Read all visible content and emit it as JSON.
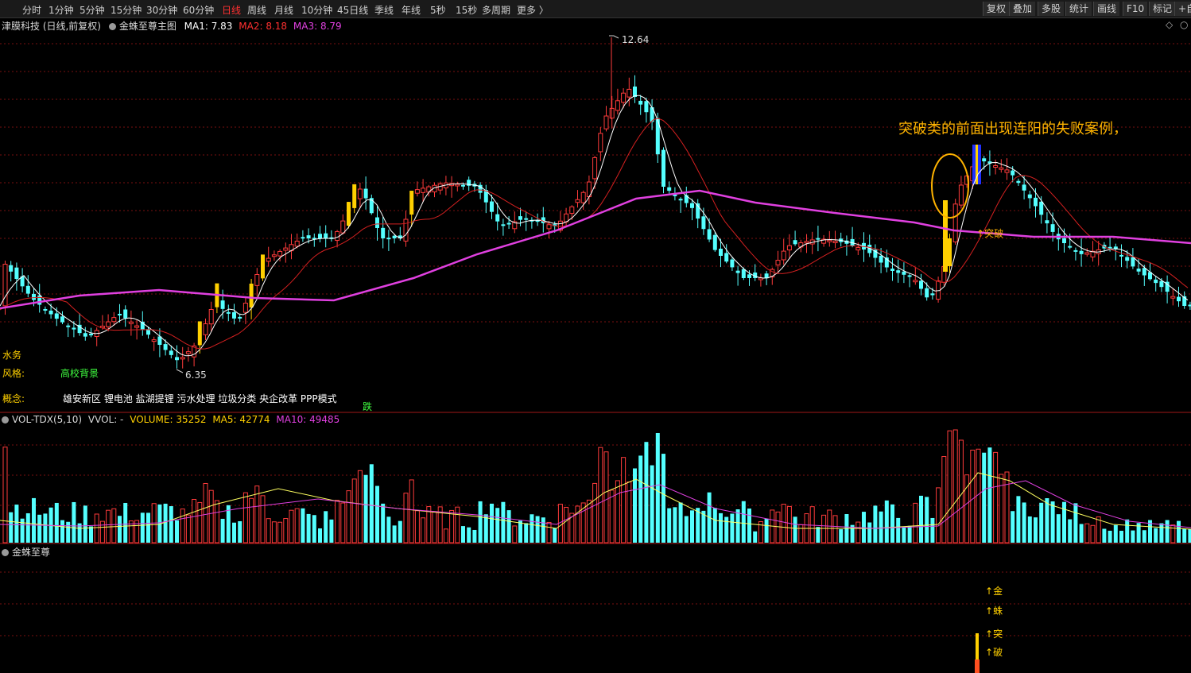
{
  "toolbar": {
    "periods": [
      "分时",
      "1分钟",
      "5分钟",
      "15分钟",
      "30分钟",
      "60分钟",
      "日线",
      "周线",
      "月线",
      "10分钟",
      "45日线",
      "季线",
      "年线",
      "5秒",
      "15秒",
      "多周期",
      "更多 〉"
    ],
    "active": "日线",
    "right_buttons": [
      "复权",
      "叠加",
      "多股",
      "统计",
      "画线",
      "F10",
      "标记",
      "+自"
    ]
  },
  "main_pane": {
    "stock_title": "津膜科技 (日线,前复权)",
    "indicator": "金蛛至尊主图",
    "ma1": "MA1: 7.83",
    "ma2": "MA2: 8.18",
    "ma3": "MA3: 8.79",
    "high_label": "12.64",
    "low_label": "6.35",
    "annotation": "突破类的前面出现连阳的失败案例，",
    "breakout_label": "突破",
    "water_label": "水务",
    "style_label": "风格:",
    "style_value": "高校背景",
    "concept_label": "概念:",
    "concept_value": "雄安新区  锂电池  盐湖提锂  污水处理  垃圾分类  央企改革  PPP模式",
    "drop_label": "跌",
    "top_right_icons": [
      "diamond-icon",
      "circle-icon"
    ]
  },
  "volume_pane": {
    "title": "VOL-TDX(5,10)",
    "vvol": "VVOL: -",
    "volume": "VOLUME: 35252",
    "ma5": "MA5: 42774",
    "ma10": "MA10: 49485"
  },
  "bottom_pane": {
    "title": "金蛛至尊",
    "signals": [
      "金",
      "蛛",
      "突",
      "破"
    ]
  },
  "colors": {
    "up": "#ff3b3b",
    "down": "#54ffff",
    "ma1": "#ffffff",
    "ma2": "#d42020",
    "ma3": "#e040e0",
    "highlight": "#ffd000",
    "blue_bar": "#2030ff",
    "grid": "#7a1010"
  }
}
